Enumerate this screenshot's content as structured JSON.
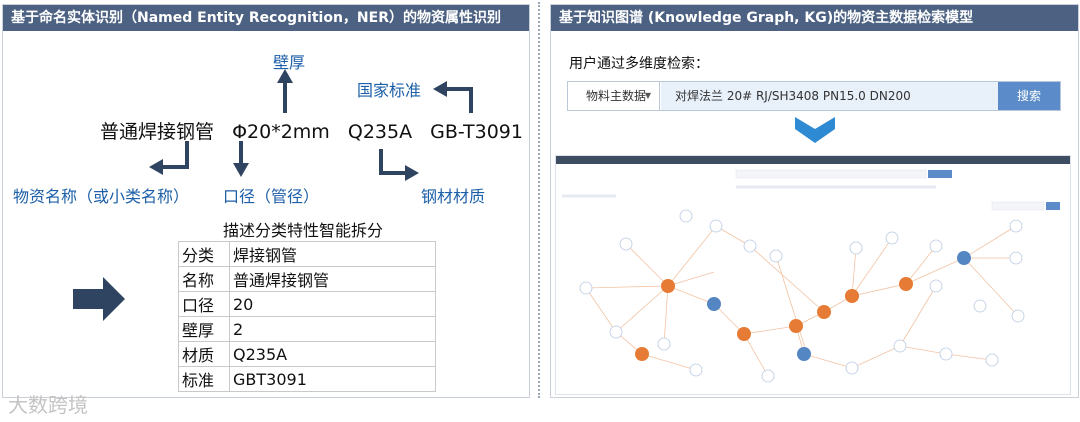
{
  "left_panel": {
    "header": "基于命名实体识别（Named Entity Recognition，NER）的物资属性识别",
    "sentence_tokens": [
      "普通焊接钢管",
      "Φ20*2mm",
      "Q235A",
      "GB-T3091"
    ],
    "labels": {
      "wall_thickness": "壁厚",
      "standard": "国家标准",
      "material_name": "物资名称（或小类名称）",
      "diameter": "口径（管径）",
      "steel_material": "钢材材质"
    },
    "table_title": "描述分类特性智能拆分",
    "table_rows": [
      {
        "key": "分类",
        "value": "焊接钢管"
      },
      {
        "key": "名称",
        "value": "普通焊接钢管"
      },
      {
        "key": "口径",
        "value": "20"
      },
      {
        "key": "壁厚",
        "value": "2"
      },
      {
        "key": "材质",
        "value": "Q235A"
      },
      {
        "key": "标准",
        "value": "GBT3091"
      }
    ],
    "watermark": "大数跨境"
  },
  "right_panel": {
    "header": "基于知识图谱 (Knowledge Graph, KG)的物资主数据检索模型",
    "search_hint": "用户通过多维度检索：",
    "search": {
      "select_value": "物料主数据",
      "query": "对焊法兰 20# RJ/SH3408 PN15.0 DN200",
      "button": "搜索"
    }
  },
  "colors": {
    "header_bg": "#4d6282",
    "label_blue": "#1d5fa8",
    "arrow_dark": "#2e4460",
    "node_orange": "#e57b35",
    "node_blue": "#5386c2",
    "chevron_blue": "#2e8ad3"
  },
  "icons": [
    "arrow-up-icon",
    "arrow-bent-left-icon",
    "arrow-bent-down-left-icon",
    "arrow-down-icon",
    "arrow-bent-down-right-icon",
    "big-right-arrow-icon",
    "chevron-down-icon",
    "double-chevron-down-icon"
  ]
}
